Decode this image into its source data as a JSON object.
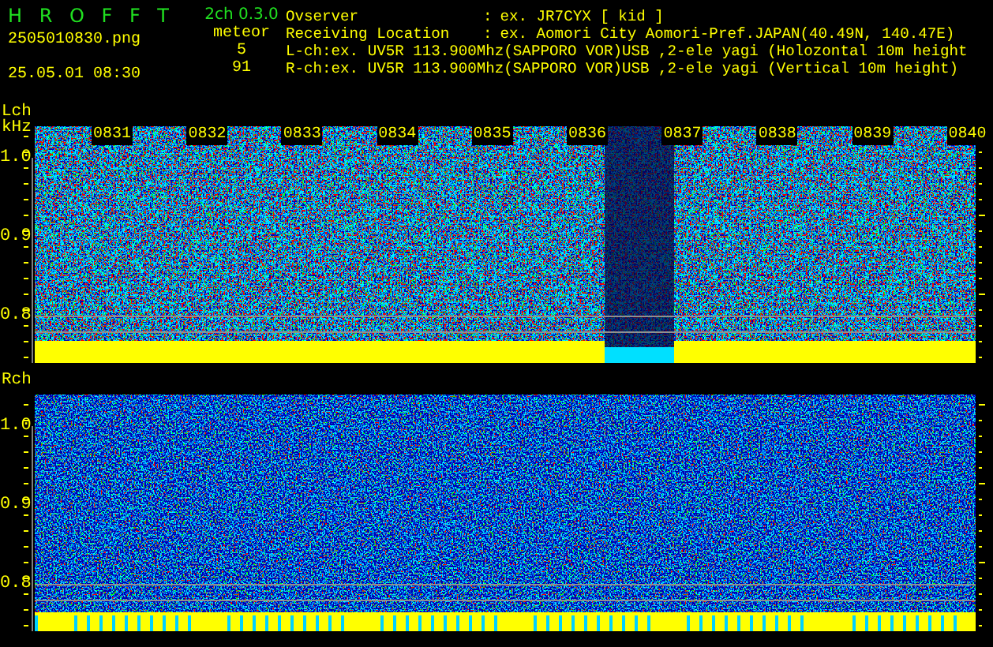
{
  "header": {
    "app_title": "H R O F F T",
    "version": "2ch 0.3.0",
    "file_name": "2505010830.png",
    "date_time": "25.05.01 08:30",
    "meteor_label": "meteor",
    "counts": [
      "5",
      "91"
    ],
    "info": [
      {
        "label": "Ovserver",
        "separator": ":",
        "value": "ex. JR7CYX [ kid ]"
      },
      {
        "label": "Receiving Location",
        "separator": ":",
        "value": "ex. Aomori City Aomori-Pref.JAPAN(40.49N, 140.47E)"
      }
    ],
    "channel_lines": [
      "L-ch:ex. UV5R 113.900Mhz(SAPPORO VOR)USB ,2-ele yagi (Holozontal 10m height",
      "R-ch:ex. UV5R 113.900Mhz(SAPPORO VOR)USB ,2-ele yagi (Vertical 10m height)"
    ]
  },
  "panels": [
    {
      "channel": "Lch",
      "unit": "kHz",
      "yticks": [
        "1.0",
        "0.9",
        "0.8"
      ],
      "time_labels": [
        "0831",
        "0832",
        "0833",
        "0834",
        "0835",
        "0836",
        "0837",
        "0838",
        "0839",
        "0840"
      ]
    },
    {
      "channel": "Rch",
      "yticks": [
        "1.0",
        "0.9",
        "0.8"
      ]
    }
  ]
}
